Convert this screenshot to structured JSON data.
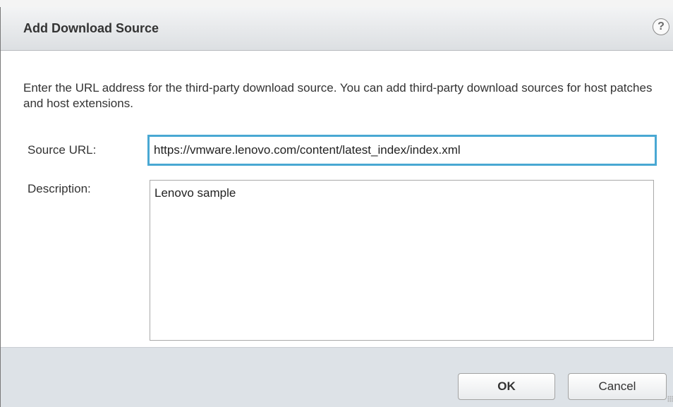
{
  "dialog": {
    "title": "Add Download Source",
    "help_label": "?",
    "instructions": "Enter the URL address for the third-party download source. You can add third-party download sources for host patches and host extensions.",
    "source_url": {
      "label": "Source URL:",
      "value": "https://vmware.lenovo.com/content/latest_index/index.xml"
    },
    "description": {
      "label": "Description:",
      "value": "Lenovo sample"
    },
    "buttons": {
      "ok_label": "OK",
      "cancel_label": "Cancel"
    }
  },
  "colors": {
    "title_bar_top": "#f3f4f5",
    "title_bar_bottom": "#dcdfe2",
    "footer_background": "#dde2e7",
    "focus_border": "#49a8d3",
    "text": "#333333"
  },
  "icons": {
    "help": "help-icon"
  }
}
